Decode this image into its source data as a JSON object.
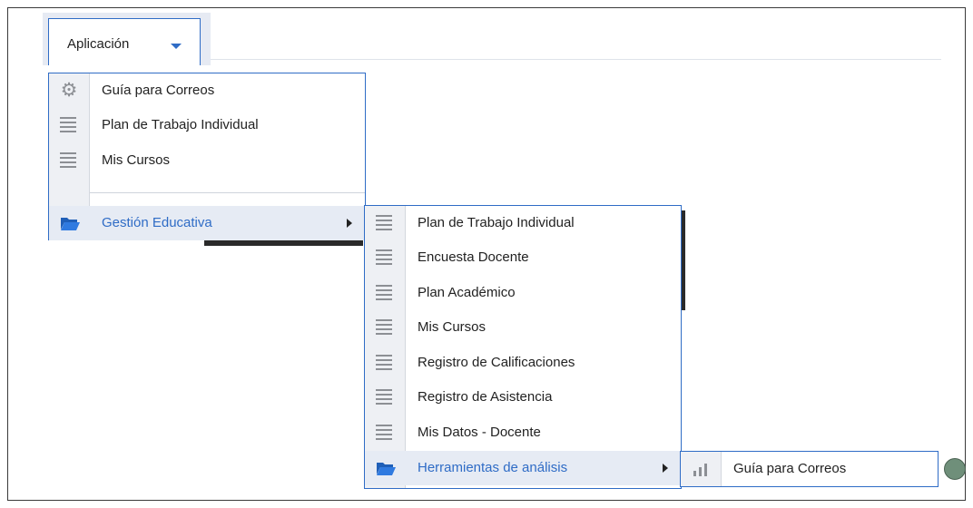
{
  "app_menu": {
    "label": "Aplicación"
  },
  "menu1": {
    "items": [
      {
        "label": "Guía para Correos",
        "icon": "gear-icon"
      },
      {
        "label": "Plan de Trabajo Individual",
        "icon": "lines-icon"
      },
      {
        "label": "Mis Cursos",
        "icon": "lines-icon"
      },
      {
        "label": "Gestión Educativa",
        "icon": "folder-icon"
      }
    ]
  },
  "menu2": {
    "items": [
      {
        "label": "Plan de Trabajo Individual",
        "icon": "lines-icon"
      },
      {
        "label": "Encuesta Docente",
        "icon": "lines-icon"
      },
      {
        "label": "Plan Académico",
        "icon": "lines-icon"
      },
      {
        "label": "Mis Cursos",
        "icon": "lines-icon"
      },
      {
        "label": "Registro de Calificaciones",
        "icon": "lines-icon"
      },
      {
        "label": "Registro de Asistencia",
        "icon": "lines-icon"
      },
      {
        "label": "Mis Datos - Docente",
        "icon": "lines-icon"
      },
      {
        "label": "Herramientas de análisis",
        "icon": "folder-icon"
      }
    ]
  },
  "menu3": {
    "items": [
      {
        "label": "Guía para Correos",
        "icon": "bar-chart-icon"
      }
    ]
  },
  "colors": {
    "accent": "#2f6cc6",
    "gutter": "#eef0f4",
    "highlight": "#e6ebf4"
  }
}
